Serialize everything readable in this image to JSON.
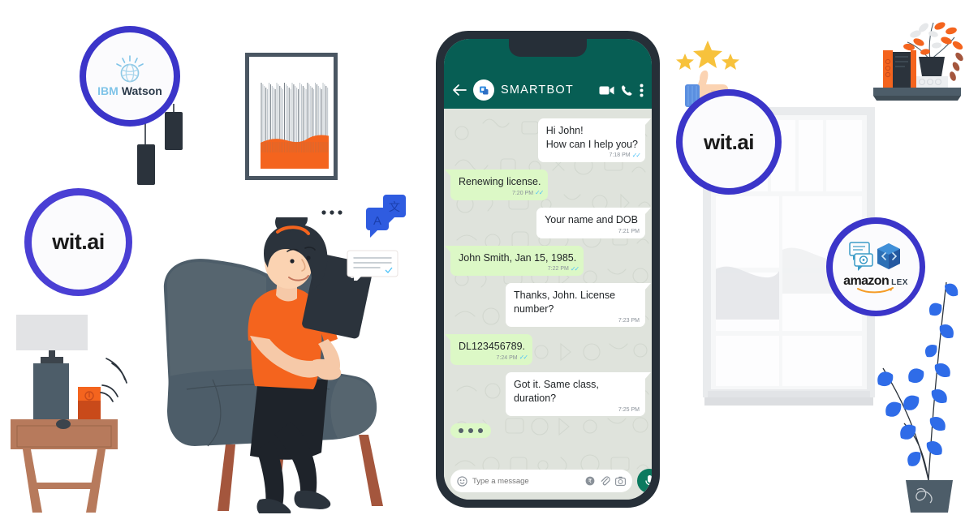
{
  "scene": {
    "title": "Chatbot platforms illustration",
    "background": "#ffffff"
  },
  "phone": {
    "header": {
      "back_icon": "arrow-left-icon",
      "avatar_icon": "bot-avatar-icon",
      "contact_name": "SMARTBOT",
      "video_icon": "video-call-icon",
      "call_icon": "phone-call-icon",
      "menu_icon": "overflow-menu-icon",
      "bar_color": "#075e54"
    },
    "messages": [
      {
        "id": "m1",
        "side": "in",
        "lines": [
          "Hi John!",
          "How can I help you?"
        ],
        "time": "7:18 PM",
        "ticks": true
      },
      {
        "id": "m2",
        "side": "out",
        "lines": [
          "Renewing license."
        ],
        "time": "7:20 PM",
        "ticks": true
      },
      {
        "id": "m3",
        "side": "in",
        "lines": [
          "Your name and DOB"
        ],
        "time": "7:21 PM",
        "ticks": false
      },
      {
        "id": "m4",
        "side": "out",
        "lines": [
          "John Smith, Jan 15, 1985."
        ],
        "time": "7:22 PM",
        "ticks": true
      },
      {
        "id": "m5",
        "side": "in",
        "lines": [
          "Thanks, John. License number?"
        ],
        "time": "7:23 PM",
        "ticks": false
      },
      {
        "id": "m6",
        "side": "out",
        "lines": [
          "DL123456789."
        ],
        "time": "7:24 PM",
        "ticks": true
      },
      {
        "id": "m7",
        "side": "in",
        "lines": [
          "Got it. Same class, duration?"
        ],
        "time": "7:25 PM",
        "ticks": false
      }
    ],
    "typing_indicator": {
      "visible": true,
      "dots": 3
    },
    "input_bar": {
      "emoji_icon": "emoji-smiley-icon",
      "placeholder": "Type a message",
      "value": "",
      "sticker_icon": "sticker-icon",
      "attach_icon": "paperclip-icon",
      "camera_icon": "camera-icon",
      "mic_icon": "microphone-icon"
    },
    "colors": {
      "incoming_bubble": "#ffffff",
      "outgoing_bubble": "#dcf8c6",
      "chat_background": "#dfe3dc",
      "tick_blue": "#4fc3f7"
    }
  },
  "badges": [
    {
      "id": "ibm-watson",
      "label": "IBM Watson",
      "label_part1": "IBM",
      "label_part2": "Watson",
      "ring_color": "#3b35c9"
    },
    {
      "id": "wit-ai-left",
      "label": "wit.ai",
      "ring_color": "#4a3fd4"
    },
    {
      "id": "wit-ai-right",
      "label": "wit.ai",
      "ring_color": "#3b35c9"
    },
    {
      "id": "amazon-lex",
      "label": "amazon LEX",
      "label_part1": "amazon",
      "label_part2": "LEX",
      "ring_color": "#3b35c9"
    }
  ],
  "rating": {
    "stars": 3,
    "star_color": "#f7c23c",
    "icon": "thumbs-up-icon"
  },
  "speech_bubbles": {
    "typing_bubble_icon": "typing-dots-bubble-icon",
    "translate_latin_label": "A",
    "translate_cjk_label": "文",
    "text_bubble_icon": "text-lines-bubble-icon"
  },
  "decor": {
    "artwork": "abstract-orange-artwork",
    "pendant_lamps": 2,
    "side_table": "nightstand-with-lamp",
    "smart_speaker": "smart-speaker-icon",
    "window": "window",
    "shelf": "wall-shelf-with-books-and-plant",
    "floor_plant": "potted-plant",
    "armchair": "armchair",
    "person": "woman-with-tablet"
  },
  "palette": {
    "orange": "#f4641e",
    "slate": "#4d5d69",
    "indigo": "#3b35c9",
    "dark": "#262f38",
    "wood": "#a4563d"
  }
}
